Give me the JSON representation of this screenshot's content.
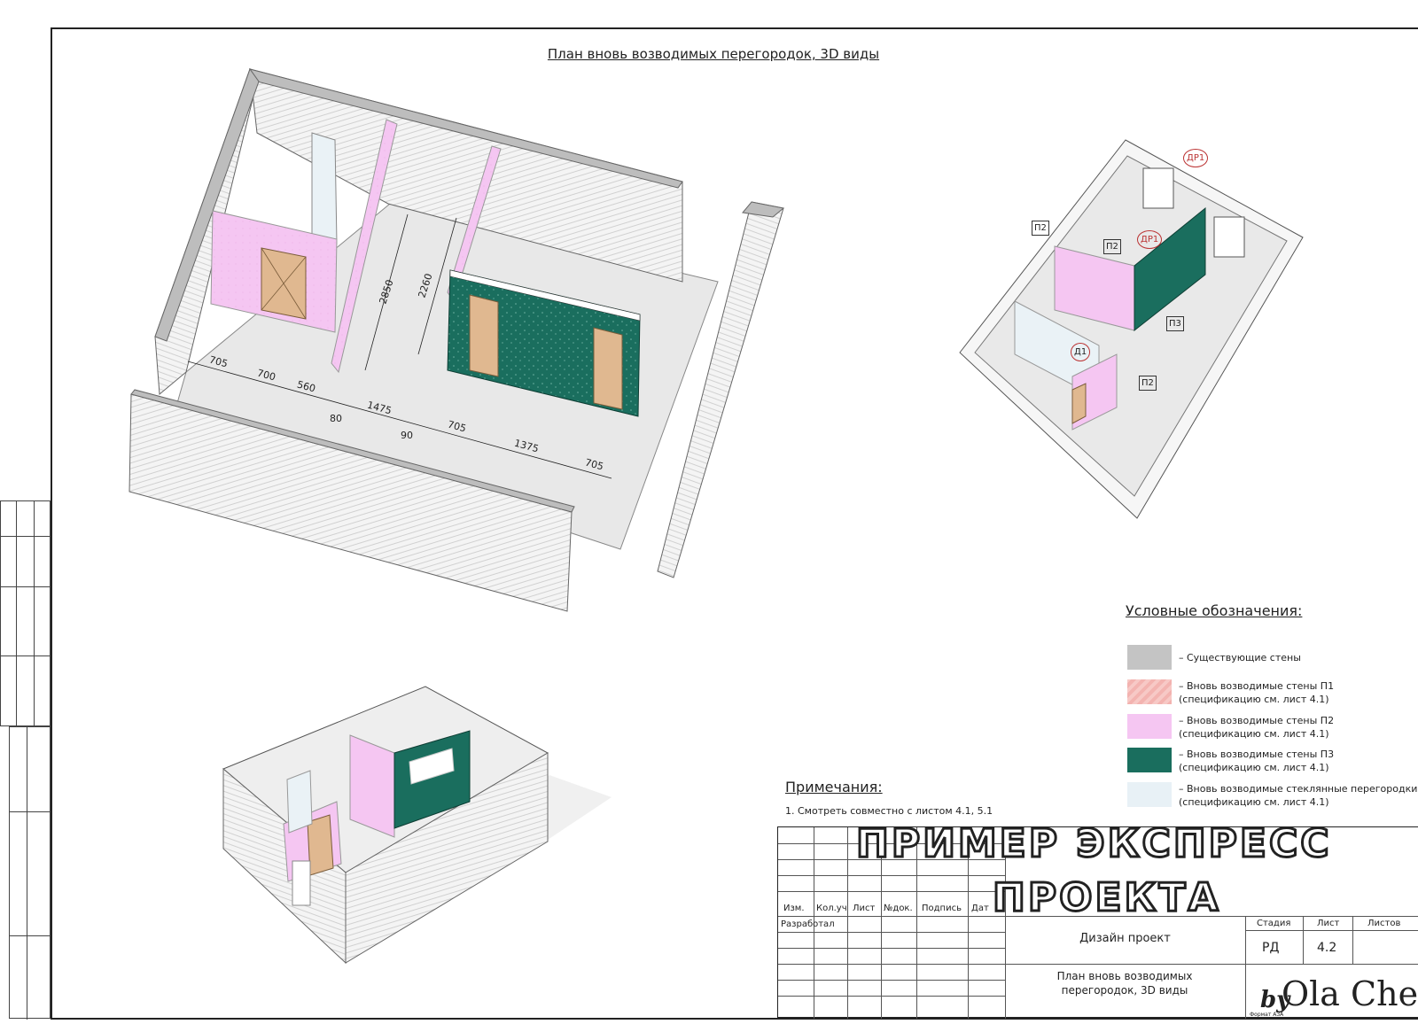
{
  "sheet": {
    "title": "План вновь возводимых перегородок, 3D виды"
  },
  "dimensions": {
    "horizontal": [
      "705",
      "700",
      "560",
      "80",
      "1475",
      "90",
      "705",
      "1375",
      "705"
    ],
    "vertical": [
      "2850",
      "2260"
    ]
  },
  "tags": {
    "dr1_a": "ДР1",
    "dr1_b": "ДР1",
    "p2_a": "П2",
    "p2_b": "П2",
    "p2_c": "П2",
    "p3": "П3",
    "d1": "Д1"
  },
  "legend": {
    "title": "Условные обозначения:",
    "items": [
      {
        "text": "– Существующие стены",
        "color": "#c4c4c4"
      },
      {
        "text": "– Вновь возводимые стены П1 (спецификацию см. лист 4.1)",
        "color": "#f3b3b0"
      },
      {
        "text": "– Вновь возводимые стены П2 (спецификацию см. лист 4.1)",
        "color": "#f5c6f2"
      },
      {
        "text": "– Вновь возводимые стены П3 (спецификацию см. лист 4.1)",
        "color": "#1a6e5e"
      },
      {
        "text": "– Вновь возводимые стеклянные перегородки (спецификацию см. лист 4.1)",
        "color": "#e8f1f6"
      }
    ]
  },
  "notes": {
    "title": "Примечания:",
    "items": [
      "1.  Смотреть совместно с листом 4.1, 5.1"
    ]
  },
  "stamp": {
    "line1": "ПРИМЕР ЭКСПРЕСС",
    "line2": "ПРОЕКТА"
  },
  "title_block": {
    "columns": [
      "Изм.",
      "Кол.уч",
      "Лист",
      "№док.",
      "Подпись",
      "Дат"
    ],
    "developed": "Разработал",
    "project": "Дизайн проект",
    "sheet_name": "План вновь возводимых перегородок, 3D виды",
    "stage_label": "Стадия",
    "sheet_label": "Лист",
    "sheets_label": "Листов",
    "stage": "РД",
    "sheet_no": "4.2",
    "format": "Формат А3А"
  },
  "logo": {
    "by": "by",
    "name": "Ola Che"
  },
  "colors": {
    "existing_wall": "#c4c4c4",
    "p2_wall": "#f5c6f2",
    "p3_wall": "#1a6e5e",
    "door": "#e0b890",
    "floor": "#e6e6e6"
  }
}
